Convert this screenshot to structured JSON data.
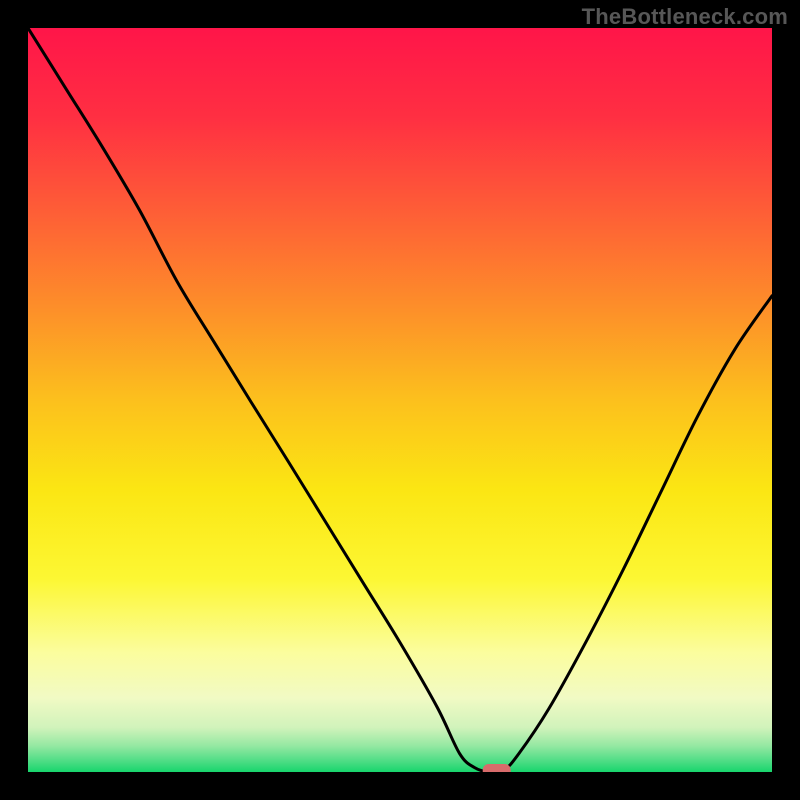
{
  "watermark": "TheBottleneck.com",
  "chart_data": {
    "type": "line",
    "title": "",
    "xlabel": "",
    "ylabel": "",
    "xlim": [
      0,
      1
    ],
    "ylim": [
      0,
      1
    ],
    "x": [
      0.0,
      0.05,
      0.1,
      0.15,
      0.2,
      0.25,
      0.3,
      0.35,
      0.4,
      0.45,
      0.5,
      0.55,
      0.58,
      0.6,
      0.62,
      0.64,
      0.66,
      0.7,
      0.75,
      0.8,
      0.85,
      0.9,
      0.95,
      1.0
    ],
    "values": [
      1.0,
      0.92,
      0.84,
      0.755,
      0.66,
      0.578,
      0.497,
      0.417,
      0.336,
      0.255,
      0.174,
      0.087,
      0.025,
      0.006,
      0.0,
      0.003,
      0.025,
      0.085,
      0.175,
      0.272,
      0.375,
      0.478,
      0.568,
      0.64
    ],
    "marker": {
      "x": 0.63,
      "y": 0.0,
      "color": "#d86b6b"
    },
    "background_gradient": {
      "stops": [
        {
          "pos": 0.0,
          "color": "#ff1549"
        },
        {
          "pos": 0.12,
          "color": "#ff2f42"
        },
        {
          "pos": 0.25,
          "color": "#fe5f36"
        },
        {
          "pos": 0.38,
          "color": "#fd9029"
        },
        {
          "pos": 0.5,
          "color": "#fcc01d"
        },
        {
          "pos": 0.62,
          "color": "#fbe613"
        },
        {
          "pos": 0.74,
          "color": "#fcf733"
        },
        {
          "pos": 0.84,
          "color": "#fbfd9e"
        },
        {
          "pos": 0.9,
          "color": "#f1fac4"
        },
        {
          "pos": 0.94,
          "color": "#d1f3bb"
        },
        {
          "pos": 0.965,
          "color": "#94e8a2"
        },
        {
          "pos": 0.985,
          "color": "#4fdd85"
        },
        {
          "pos": 1.0,
          "color": "#18d56d"
        }
      ]
    }
  }
}
